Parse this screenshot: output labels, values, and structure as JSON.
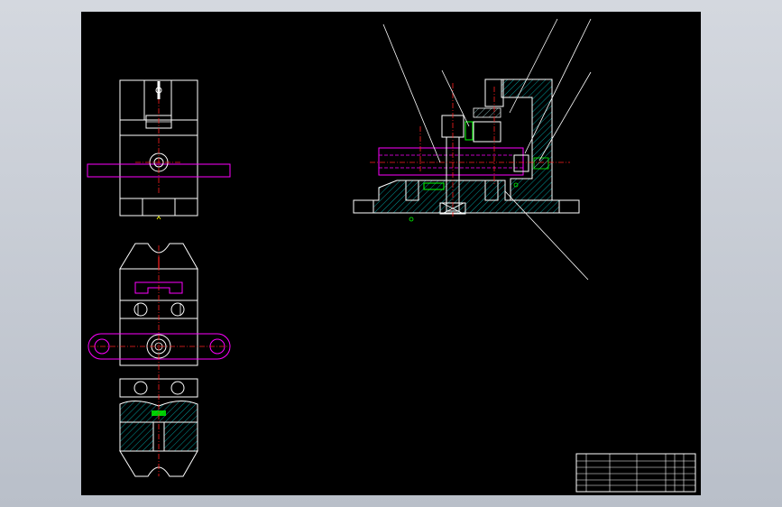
{
  "canvas": {
    "background": "#c9ced6",
    "sheet_color": "#000000"
  },
  "colors": {
    "outline": "#ffffff",
    "center_line": "#ff2020",
    "hidden_line": "#ff00ff",
    "hatch": "#00c8c8",
    "leader": "#ffffff",
    "accent_green": "#00ff00",
    "marker_yellow": "#ffff00"
  },
  "views": {
    "front_view": "front-view",
    "top_view": "top-view",
    "section_view": "section-view",
    "title_block": "title-block"
  },
  "title_block": {
    "footer_labels": [
      "",
      "",
      "",
      "",
      "",
      "",
      ""
    ]
  }
}
